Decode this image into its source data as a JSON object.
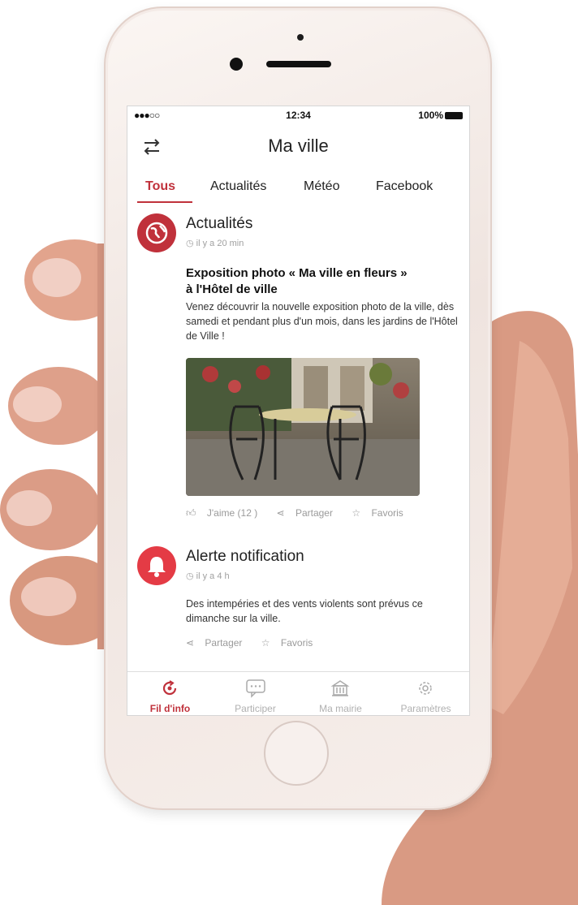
{
  "status_bar": {
    "carrier": "●●●○○",
    "time": "12:34",
    "battery": "100%"
  },
  "header": {
    "title": "Ma ville"
  },
  "tabs": [
    {
      "label": "Tous",
      "active": true
    },
    {
      "label": "Actualités",
      "active": false
    },
    {
      "label": "Météo",
      "active": false
    },
    {
      "label": "Facebook",
      "active": false
    }
  ],
  "feed": [
    {
      "category": "Actualités",
      "time": "il y a 20 min",
      "headline_line1": "Exposition photo « Ma ville en fleurs »",
      "headline_line2": "à l'Hôtel de ville",
      "body": "Venez découvrir la nouvelle exposition photo de la ville, dès samedi et pendant plus d'un mois, dans les jardins de l'Hôtel de Ville !",
      "actions": {
        "like": "J'aime (12 )",
        "share": "Partager",
        "favorite": "Favoris"
      }
    },
    {
      "category": "Alerte notification",
      "time": "il y a 4 h",
      "body": "Des intempéries et des vents violents sont prévus ce dimanche sur la ville.",
      "actions": {
        "share": "Partager",
        "favorite": "Favoris"
      }
    }
  ],
  "bottom_nav": [
    {
      "label": "Fil d'info",
      "icon": "refresh-feed-icon",
      "active": true
    },
    {
      "label": "Participer",
      "icon": "chat-bubble-icon",
      "active": false
    },
    {
      "label": "Ma mairie",
      "icon": "town-hall-icon",
      "active": false
    },
    {
      "label": "Paramètres",
      "icon": "gear-icon",
      "active": false
    }
  ],
  "colors": {
    "accent": "#c0313b",
    "alert": "#e43b45"
  }
}
